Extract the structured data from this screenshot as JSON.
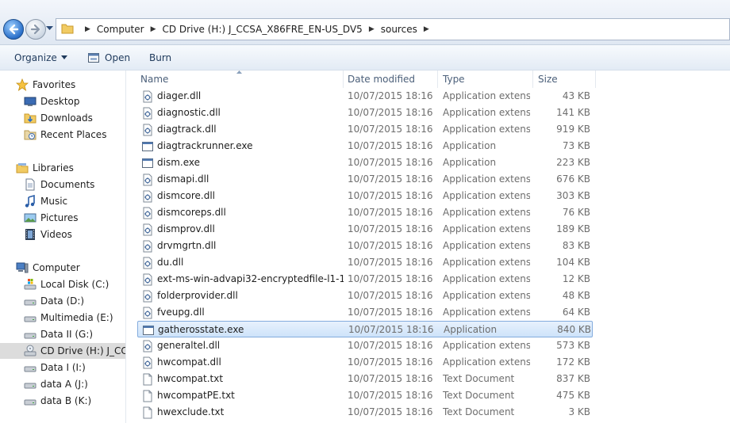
{
  "breadcrumbs": [
    "Computer",
    "CD Drive (H:) J_CCSA_X86FRE_EN-US_DV5",
    "sources"
  ],
  "toolbar": {
    "organize_label": "Organize",
    "open_label": "Open",
    "burn_label": "Burn"
  },
  "nav": {
    "favorites": {
      "label": "Favorites",
      "items": [
        "Desktop",
        "Downloads",
        "Recent Places"
      ]
    },
    "libraries": {
      "label": "Libraries",
      "items": [
        "Documents",
        "Music",
        "Pictures",
        "Videos"
      ]
    },
    "computer": {
      "label": "Computer",
      "items": [
        "Local Disk (C:)",
        "Data (D:)",
        "Multimedia (E:)",
        "Data II (G:)",
        "CD Drive (H:) J_CCSA",
        "Data I (I:)",
        "data A (J:)",
        "data B (K:)"
      ]
    }
  },
  "columns": {
    "name": "Name",
    "date": "Date modified",
    "type": "Type",
    "size": "Size"
  },
  "files": [
    {
      "name": "diager.dll",
      "date": "10/07/2015 18:16",
      "type": "Application extens...",
      "size": "43 KB",
      "icon": "dll-icon"
    },
    {
      "name": "diagnostic.dll",
      "date": "10/07/2015 18:16",
      "type": "Application extens...",
      "size": "141 KB",
      "icon": "dll-icon"
    },
    {
      "name": "diagtrack.dll",
      "date": "10/07/2015 18:16",
      "type": "Application extens...",
      "size": "919 KB",
      "icon": "dll-icon"
    },
    {
      "name": "diagtrackrunner.exe",
      "date": "10/07/2015 18:16",
      "type": "Application",
      "size": "73 KB",
      "icon": "exe-icon"
    },
    {
      "name": "dism.exe",
      "date": "10/07/2015 18:16",
      "type": "Application",
      "size": "223 KB",
      "icon": "exe-icon"
    },
    {
      "name": "dismapi.dll",
      "date": "10/07/2015 18:16",
      "type": "Application extens...",
      "size": "676 KB",
      "icon": "dll-icon"
    },
    {
      "name": "dismcore.dll",
      "date": "10/07/2015 18:16",
      "type": "Application extens...",
      "size": "303 KB",
      "icon": "dll-icon"
    },
    {
      "name": "dismcoreps.dll",
      "date": "10/07/2015 18:16",
      "type": "Application extens...",
      "size": "76 KB",
      "icon": "dll-icon"
    },
    {
      "name": "dismprov.dll",
      "date": "10/07/2015 18:16",
      "type": "Application extens...",
      "size": "189 KB",
      "icon": "dll-icon"
    },
    {
      "name": "drvmgrtn.dll",
      "date": "10/07/2015 18:16",
      "type": "Application extens...",
      "size": "83 KB",
      "icon": "dll-icon"
    },
    {
      "name": "du.dll",
      "date": "10/07/2015 18:16",
      "type": "Application extens...",
      "size": "104 KB",
      "icon": "dll-icon"
    },
    {
      "name": "ext-ms-win-advapi32-encryptedfile-l1-1-...",
      "date": "10/07/2015 18:16",
      "type": "Application extens...",
      "size": "12 KB",
      "icon": "dll-icon"
    },
    {
      "name": "folderprovider.dll",
      "date": "10/07/2015 18:16",
      "type": "Application extens...",
      "size": "48 KB",
      "icon": "dll-icon"
    },
    {
      "name": "fveupg.dll",
      "date": "10/07/2015 18:16",
      "type": "Application extens...",
      "size": "64 KB",
      "icon": "dll-icon"
    },
    {
      "name": "gatherosstate.exe",
      "date": "10/07/2015 18:16",
      "type": "Application",
      "size": "840 KB",
      "icon": "exe-icon",
      "selected": true
    },
    {
      "name": "generaltel.dll",
      "date": "10/07/2015 18:16",
      "type": "Application extens...",
      "size": "573 KB",
      "icon": "dll-icon"
    },
    {
      "name": "hwcompat.dll",
      "date": "10/07/2015 18:16",
      "type": "Application extens...",
      "size": "172 KB",
      "icon": "dll-icon"
    },
    {
      "name": "hwcompat.txt",
      "date": "10/07/2015 18:16",
      "type": "Text Document",
      "size": "837 KB",
      "icon": "txt-icon"
    },
    {
      "name": "hwcompatPE.txt",
      "date": "10/07/2015 18:16",
      "type": "Text Document",
      "size": "475 KB",
      "icon": "txt-icon"
    },
    {
      "name": "hwexclude.txt",
      "date": "10/07/2015 18:16",
      "type": "Text Document",
      "size": "3 KB",
      "icon": "txt-icon"
    }
  ]
}
